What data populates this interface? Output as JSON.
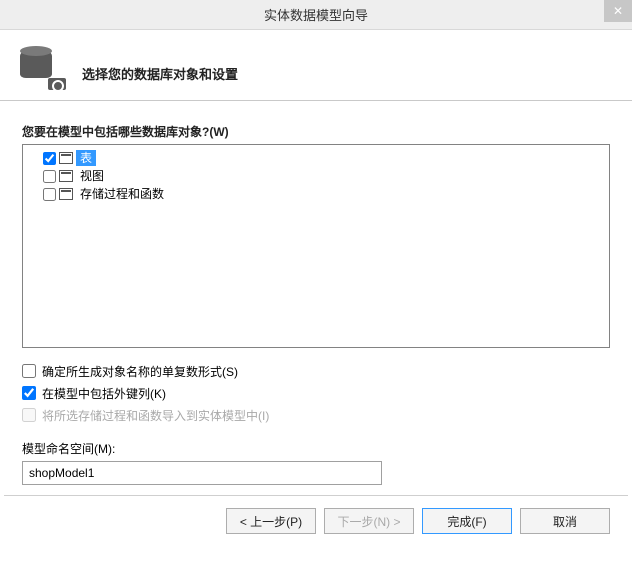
{
  "window": {
    "title": "实体数据模型向导"
  },
  "header": {
    "subtitle": "选择您的数据库对象和设置"
  },
  "tree": {
    "question": "您要在模型中包括哪些数据库对象?(W)",
    "items": [
      {
        "label": "表",
        "checked": true,
        "selected": true
      },
      {
        "label": "视图",
        "checked": false,
        "selected": false
      },
      {
        "label": "存储过程和函数",
        "checked": false,
        "selected": false
      }
    ]
  },
  "options": {
    "pluralize": {
      "label": "确定所生成对象名称的单复数形式(S)",
      "checked": false
    },
    "include_fk": {
      "label": "在模型中包括外键列(K)",
      "checked": true
    },
    "import_sp": {
      "label": "将所选存储过程和函数导入到实体模型中(I)",
      "checked": false
    }
  },
  "namespace": {
    "label": "模型命名空间(M):",
    "value": "shopModel1"
  },
  "buttons": {
    "prev": "< 上一步(P)",
    "next": "下一步(N) >",
    "finish": "完成(F)",
    "cancel": "取消"
  }
}
